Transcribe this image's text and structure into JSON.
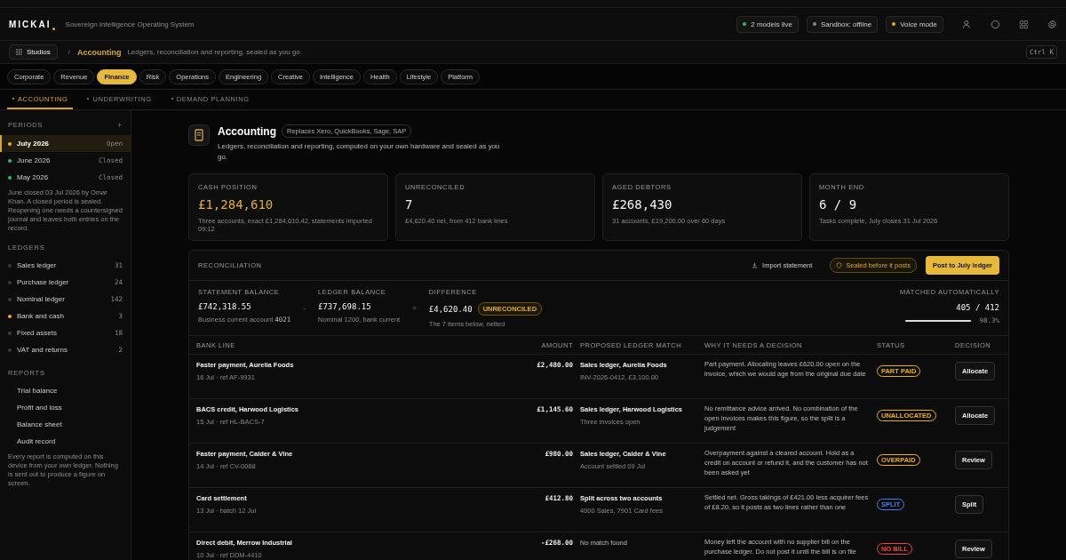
{
  "brand": {
    "name": "MICKAI",
    "tagline": "Sovereign Intelligence Operating System"
  },
  "status_chips": [
    {
      "label": "2 models live",
      "color": "#22c55e"
    },
    {
      "label": "Sandbox: offline",
      "color": "#8a8a8a"
    },
    {
      "label": "Voice mode",
      "color": "#eab308"
    }
  ],
  "breadcrumb": {
    "studios": "Studios",
    "separator": "/",
    "current": "Accounting",
    "description": "Ledgers, reconciliation and reporting, sealed as you go",
    "shortcut": "Ctrl K"
  },
  "categories": [
    {
      "label": "Corporate",
      "selected": false
    },
    {
      "label": "Revenue",
      "selected": false
    },
    {
      "label": "Finance",
      "selected": true
    },
    {
      "label": "Risk",
      "selected": false
    },
    {
      "label": "Operations",
      "selected": false
    },
    {
      "label": "Engineering",
      "selected": false
    },
    {
      "label": "Creative",
      "selected": false
    },
    {
      "label": "Intelligence",
      "selected": false
    },
    {
      "label": "Health",
      "selected": false
    },
    {
      "label": "Lifestyle",
      "selected": false
    },
    {
      "label": "Platform",
      "selected": false
    }
  ],
  "subtabs": [
    {
      "label": "ACCOUNTING",
      "selected": true
    },
    {
      "label": "UNDERWRITING",
      "selected": false
    },
    {
      "label": "DEMAND PLANNING",
      "selected": false
    }
  ],
  "sidebar": {
    "periods_title": "PERIODS",
    "add": "+",
    "periods": [
      {
        "label": "July 2026",
        "state": "Open",
        "color": "#eab308",
        "selected": true
      },
      {
        "label": "June 2026",
        "state": "Closed",
        "color": "#22c55e",
        "selected": false
      },
      {
        "label": "May 2026",
        "state": "Closed",
        "color": "#22c55e",
        "selected": false
      }
    ],
    "periods_note": "June closed 03 Jul 2026 by Omar Khan. A closed period is sealed. Reopening one needs a countersigned journal and leaves both entries on the record.",
    "ledgers_title": "LEDGERS",
    "ledgers": [
      {
        "label": "Sales ledger",
        "count": "31",
        "color": "#3a3a3a"
      },
      {
        "label": "Purchase ledger",
        "count": "24",
        "color": "#3a3a3a"
      },
      {
        "label": "Nominal ledger",
        "count": "142",
        "color": "#3a3a3a"
      },
      {
        "label": "Bank and cash",
        "count": "3",
        "color": "#eab308"
      },
      {
        "label": "Fixed assets",
        "count": "18",
        "color": "#3a3a3a"
      },
      {
        "label": "VAT and returns",
        "count": "2",
        "color": "#3a3a3a"
      }
    ],
    "reports_title": "REPORTS",
    "reports": [
      "Trial balance",
      "Profit and loss",
      "Balance sheet",
      "Audit record"
    ],
    "reports_note": "Every report is computed on this device from your own ledger. Nothing is sent out to produce a figure on screen."
  },
  "page": {
    "title": "Accounting",
    "badge": "Replaces Xero, QuickBooks, Sage, SAP",
    "description": "Ledgers, reconciliation and reporting, computed on your own hardware and sealed as you go."
  },
  "kpis": [
    {
      "label": "CASH POSITION",
      "value": "£1,284,610",
      "note": "Three accounts, exact £1,284,610.42, statements imported 09:12",
      "highlight": true
    },
    {
      "label": "UNRECONCILED",
      "value": "7",
      "note": "£4,620.40 net, from 412 bank lines",
      "highlight": false
    },
    {
      "label": "AGED DEBTORS",
      "value": "£268,430",
      "note": "31 accounts, £19,200.00 over 60 days",
      "highlight": false
    },
    {
      "label": "MONTH END",
      "value": "6 / 9",
      "note": "Tasks complete, July closes 31 Jul 2026",
      "highlight": false
    }
  ],
  "reconciliation": {
    "title": "RECONCILIATION",
    "import": "Import statement",
    "sealed": "Sealed before it posts",
    "post": "Post to July ledger",
    "statement": {
      "label": "STATEMENT BALANCE",
      "value": "£742,318.55",
      "note": "Business current account ",
      "account": "4021"
    },
    "minus": "-",
    "ledger": {
      "label": "LEDGER BALANCE",
      "value": "£737,698.15",
      "note": "Nominal 1200, bank current"
    },
    "equals": "=",
    "difference": {
      "label": "DIFFERENCE",
      "value": "£4,620.40",
      "badge": "UNRECONCILED",
      "note": "The 7 items below, netted"
    },
    "matched": {
      "label": "MATCHED AUTOMATICALLY",
      "value": "405 / 412",
      "level": 0.983,
      "percent": "98.3%"
    },
    "columns": [
      "BANK LINE",
      "AMOUNT",
      "PROPOSED LEDGER MATCH",
      "WHY IT NEEDS A DECISION",
      "STATUS",
      "DECISION"
    ],
    "rows": [
      {
        "line": "Faster payment, Aurelia Foods",
        "ref": "16 Jul · ref AF-9931",
        "amount": "£2,480.00",
        "match": "Sales ledger, Aurelia Foods",
        "match_note": "INV-2026-0412, £3,100.00",
        "why": "Part payment. Allocating leaves £620.00 open on the invoice, which we would age from the original due date",
        "status": "PART PAID",
        "color": "#eab308",
        "decision": "Allocate"
      },
      {
        "line": "BACS credit, Harwood Logistics",
        "ref": "15 Jul · ref HL-BACS-7",
        "amount": "£1,145.60",
        "match": "Sales ledger, Harwood Logistics",
        "match_note": "Three invoices open",
        "why": "No remittance advice arrived. No combination of the open invoices makes this figure, so the split is a judgement",
        "status": "UNALLOCATED",
        "color": "#eab308",
        "decision": "Allocate"
      },
      {
        "line": "Faster payment, Calder & Vine",
        "ref": "14 Jul · ref CV-0088",
        "amount": "£980.00",
        "match": "Sales ledger, Calder & Vine",
        "match_note": "Account settled 09 Jul",
        "why": "Overpayment against a cleared account. Hold as a credit on account or refund it, and the customer has not been asked yet",
        "status": "OVERPAID",
        "color": "#eab308",
        "decision": "Review"
      },
      {
        "line": "Card settlement",
        "ref": "13 Jul · batch 12 Jul",
        "amount": "£412.80",
        "match": "Split across two accounts",
        "match_note": "4000 Sales, 7901 Card fees",
        "why": "Settled net. Gross takings of £421.00 less acquirer fees of £8.20, so it posts as two lines rather than one",
        "status": "SPLIT",
        "color": "#3b82f6",
        "decision": "Split"
      },
      {
        "line": "Direct debit, Merrow Industrial",
        "ref": "10 Jul · ref DDM-4410",
        "amount": "-£268.00",
        "match": "No match found",
        "why": "Money left the account with no supplier bill on the purchase ledger. Do not post it until the bill is on file",
        "status": "NO BILL",
        "color": "#ef4444",
        "decision": "Review"
      }
    ]
  }
}
